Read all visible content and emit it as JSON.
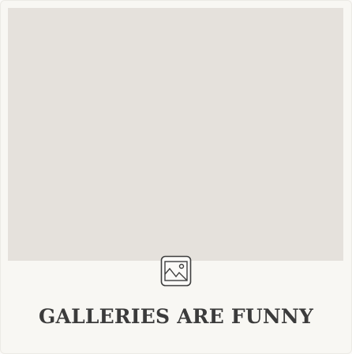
{
  "card": {
    "title": "GALLERIES ARE FUNNY",
    "icon": "image-placeholder-icon",
    "colors": {
      "thumbnail": "#e5e1dc",
      "background": "#f8f7f3",
      "title": "#3b3b3b"
    }
  }
}
